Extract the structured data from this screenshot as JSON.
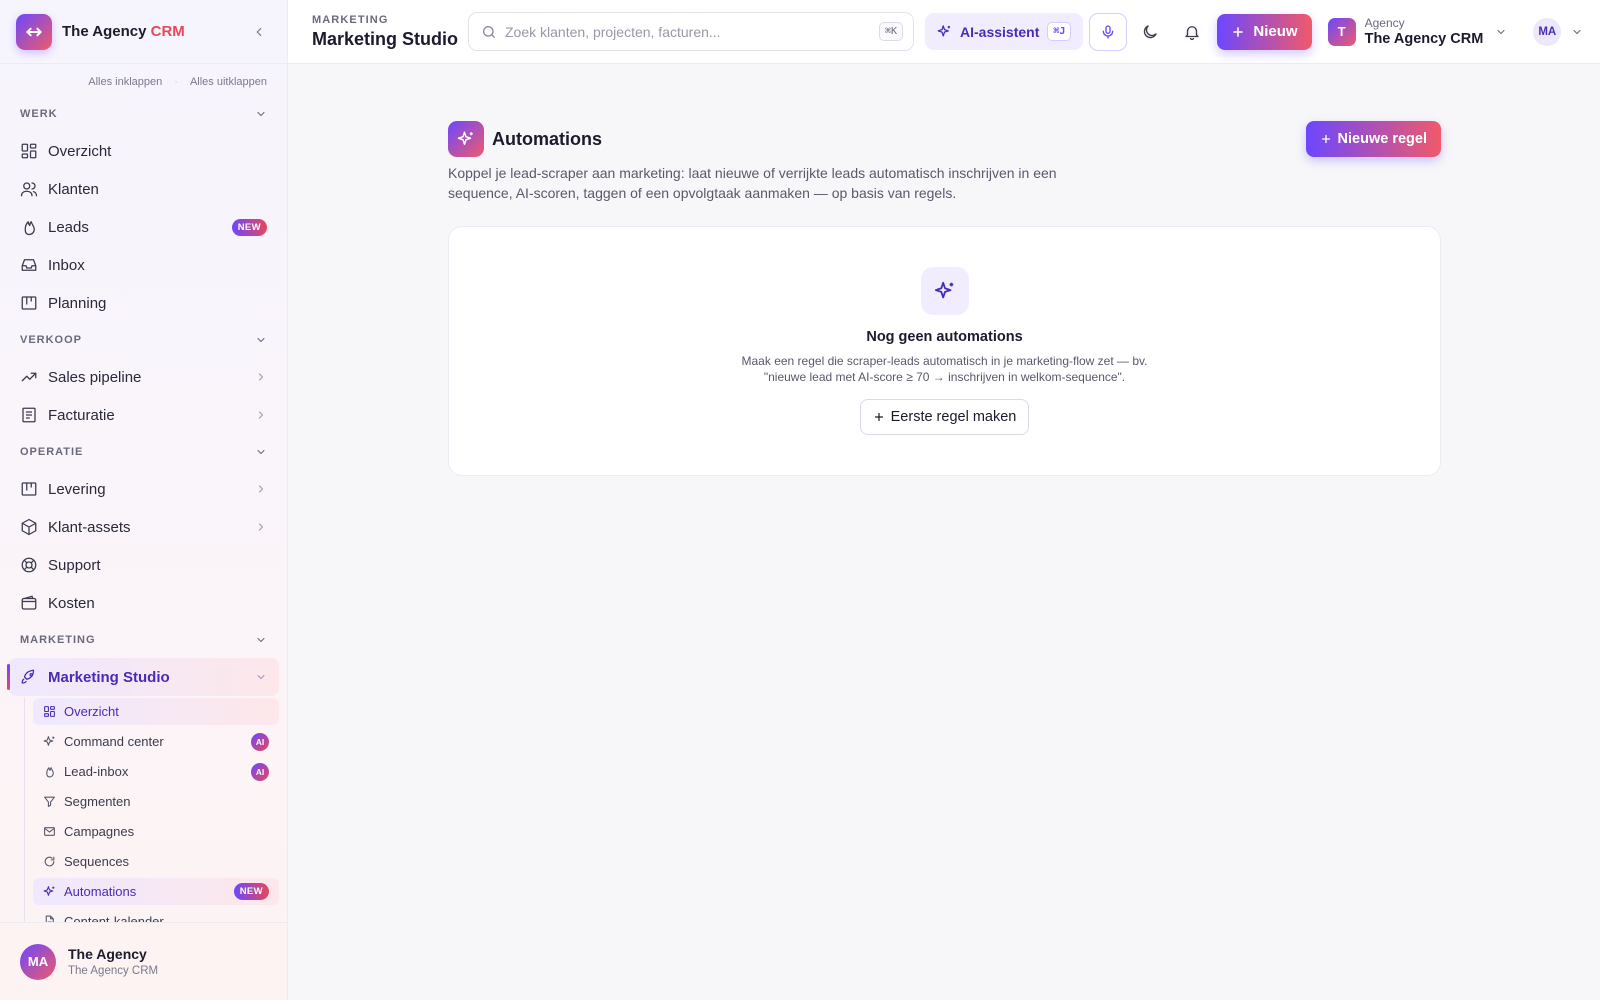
{
  "brand": {
    "name_main": "The Agency ",
    "name_accent": "CRM",
    "accent_color": "#e9475b",
    "primary_color": "#6c47ff"
  },
  "sidebar": {
    "collapse_all": "Alles inklappen",
    "expand_all": "Alles uitklappen",
    "sections": {
      "werk": "WERK",
      "verkoop": "VERKOOP",
      "operatie": "OPERATIE",
      "marketing": "MARKETING"
    },
    "items": {
      "overzicht": "Overzicht",
      "klanten": "Klanten",
      "leads": "Leads",
      "leads_badge": "NEW",
      "inbox": "Inbox",
      "planning": "Planning",
      "sales_pipeline": "Sales pipeline",
      "facturatie": "Facturatie",
      "levering": "Levering",
      "klant_assets": "Klant-assets",
      "support": "Support",
      "kosten": "Kosten",
      "marketing_studio": "Marketing Studio"
    },
    "sub_items": {
      "overzicht": "Overzicht",
      "command_center": "Command center",
      "command_center_badge": "AI",
      "lead_inbox": "Lead-inbox",
      "lead_inbox_badge": "AI",
      "segmenten": "Segmenten",
      "campagnes": "Campagnes",
      "sequences": "Sequences",
      "automations": "Automations",
      "automations_badge": "NEW",
      "content_kalender": "Content-kalender"
    },
    "footer": {
      "initials": "MA",
      "name": "The Agency",
      "subtitle": "The Agency CRM"
    }
  },
  "topbar": {
    "eyebrow": "MARKETING",
    "title": "Marketing Studio",
    "search_placeholder": "Zoek klanten, projecten, facturen...",
    "search_shortcut": "⌘K",
    "ai_label": "AI-assistent",
    "ai_shortcut": "⌘J",
    "new_label": "Nieuw",
    "workspace": {
      "logo": "T",
      "label": "Agency",
      "name": "The Agency CRM"
    },
    "user_initials": "MA"
  },
  "main": {
    "title": "Automations",
    "description": "Koppel je lead-scraper aan marketing: laat nieuwe of verrijkte leads automatisch inschrijven in een sequence, AI-scoren, taggen of een opvolgtaak aanmaken — op basis van regels.",
    "new_rule_label": "Nieuwe regel",
    "empty": {
      "title": "Nog geen automations",
      "desc_line1": "Maak een regel die scraper-leads automatisch in je marketing-flow zet — bv.",
      "desc_line2": "\"nieuwe lead met AI-score ≥ 70 → inschrijven in welkom-sequence\".",
      "button_label": "Eerste regel maken"
    }
  },
  "icons": [
    "arrows-logo-icon",
    "chevron-left-icon",
    "chevron-down-icon",
    "chevron-right-icon",
    "grid-icon",
    "users-icon",
    "flame-icon",
    "inbox-icon",
    "kanban-icon",
    "trend-up-icon",
    "receipt-icon",
    "box-icon",
    "lifebuoy-icon",
    "wallet-icon",
    "rocket-icon",
    "sparkle-icon",
    "filter-icon",
    "mail-icon",
    "refresh-icon",
    "file-icon",
    "search-icon",
    "mic-icon",
    "moon-icon",
    "bell-icon",
    "plus-icon"
  ]
}
